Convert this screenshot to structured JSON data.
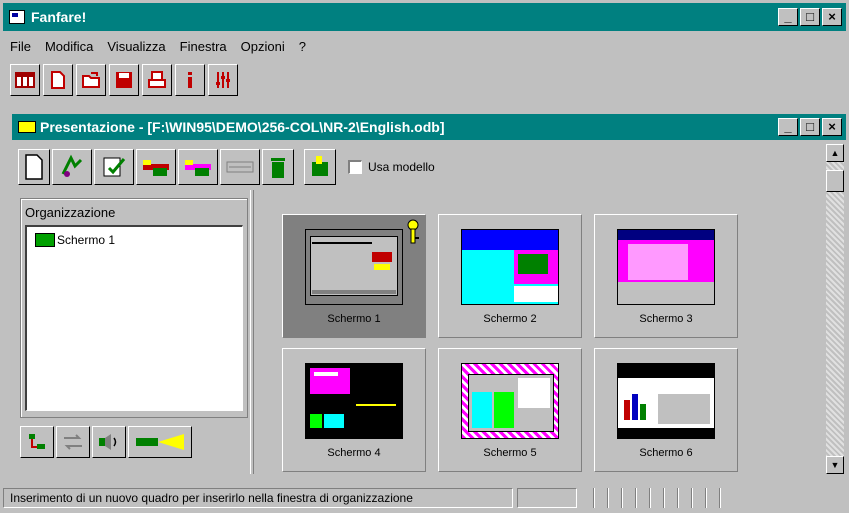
{
  "app": {
    "title": "Fanfare!",
    "window_buttons": [
      "_",
      "□",
      "×"
    ]
  },
  "menu": [
    "File",
    "Modifica",
    "Visualizza",
    "Finestra",
    "Opzioni",
    "?"
  ],
  "main_toolbar": [
    {
      "name": "grid-icon"
    },
    {
      "name": "new-document-icon"
    },
    {
      "name": "open-folder-icon"
    },
    {
      "name": "save-icon"
    },
    {
      "name": "print-icon"
    },
    {
      "name": "info-icon"
    },
    {
      "name": "mixer-icon"
    }
  ],
  "child_window": {
    "title": "Presentazione - [F:\\WIN95\\DEMO\\256-COL\\NR-2\\English.odb]",
    "use_template_label": "Usa modello",
    "use_template_checked": false
  },
  "organization": {
    "label": "Organizzazione",
    "tree_items": [
      "Schermo 1"
    ]
  },
  "screens": [
    {
      "label": "Schermo 1",
      "selected": true
    },
    {
      "label": "Schermo 2",
      "selected": false
    },
    {
      "label": "Schermo 3",
      "selected": false
    },
    {
      "label": "Schermo 4",
      "selected": false
    },
    {
      "label": "Schermo 5",
      "selected": false
    },
    {
      "label": "Schermo 6",
      "selected": false
    }
  ],
  "status": {
    "text": "Inserimento di un nuovo quadro per inserirlo nella finestra di organizzazione"
  },
  "colors": {
    "titlebar": "#008080",
    "face": "#c0c0c0"
  }
}
